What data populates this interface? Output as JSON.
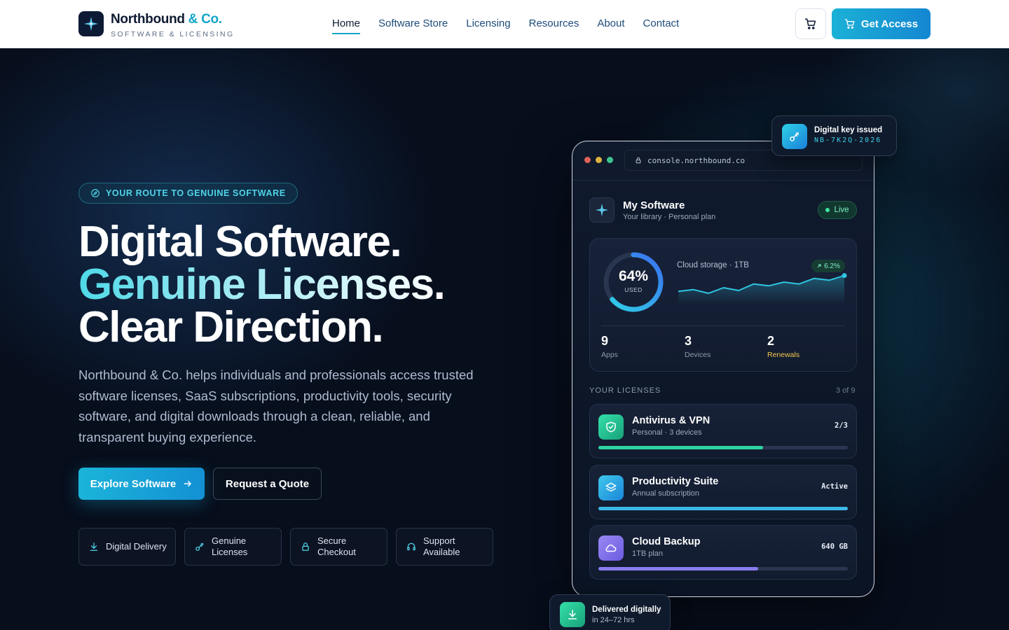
{
  "header": {
    "brand_name": "Northbound",
    "brand_accent": "& Co.",
    "brand_tagline": "SOFTWARE & LICENSING",
    "nav": [
      "Home",
      "Software Store",
      "Licensing",
      "Resources",
      "About",
      "Contact"
    ],
    "active_nav": "Home",
    "cta_label": "Get Access",
    "icons": {
      "logo": "star-compass-icon",
      "cart": "cart-icon"
    }
  },
  "hero": {
    "eyebrow": "YOUR ROUTE TO GENUINE SOFTWARE",
    "headline_line1": "Digital Software.",
    "headline_line2": "Genuine Licenses.",
    "headline_line3": "Clear Direction.",
    "description": "Northbound & Co. helps individuals and professionals access trusted software licenses, SaaS subscriptions, productivity tools, security software, and digital downloads through a clean, reliable, and transparent buying experience.",
    "primary_button": "Explore Software",
    "secondary_button": "Request a Quote",
    "features": [
      {
        "label": "Digital Delivery",
        "icon": "download-icon"
      },
      {
        "label": "Genuine Licenses",
        "icon": "key-icon"
      },
      {
        "label": "Secure Checkout",
        "icon": "lock-icon"
      },
      {
        "label": "Support Available",
        "icon": "headset-icon"
      }
    ]
  },
  "console": {
    "url": "console.northbound.co",
    "app_title": "My Software",
    "app_subtitle": "Your library · Personal plan",
    "status": "Live",
    "usage": {
      "percent_text": "64%",
      "percent": 64,
      "label": "USED"
    },
    "storage_label": "Cloud storage · 1TB",
    "trend": "6.2%",
    "sparkline": [
      30,
      32,
      28,
      34,
      31,
      38,
      36,
      40,
      38,
      44,
      42,
      47
    ],
    "stats": [
      {
        "value": "9",
        "label": "Apps"
      },
      {
        "value": "3",
        "label": "Devices"
      },
      {
        "value": "2",
        "label": "Renewals"
      }
    ],
    "licenses_label": "YOUR LICENSES",
    "licenses_count": "3 of 9",
    "licenses": [
      {
        "name": "Antivirus & VPN",
        "sub": "Personal · 3 devices",
        "value": "2/3",
        "progress": 0.66,
        "icon": "shield-check-icon",
        "color": "#2fd4a0"
      },
      {
        "name": "Productivity Suite",
        "sub": "Annual subscription",
        "value": "Active",
        "progress": 1.0,
        "icon": "layers-icon",
        "color": "#3bb8e8"
      },
      {
        "name": "Cloud Backup",
        "sub": "1TB plan",
        "value": "640 GB",
        "progress": 0.64,
        "icon": "cloud-icon",
        "color": "#8a7cf0"
      }
    ]
  },
  "badges": {
    "key_title": "Digital key issued",
    "key_code": "NB-7K2Q-2026",
    "delivery_title": "Delivered digitally",
    "delivery_sub": "in 24–72 hrs"
  },
  "colors": {
    "accent": "#14a5c9",
    "success": "#3ee6a3",
    "warning": "#f2c94c"
  }
}
